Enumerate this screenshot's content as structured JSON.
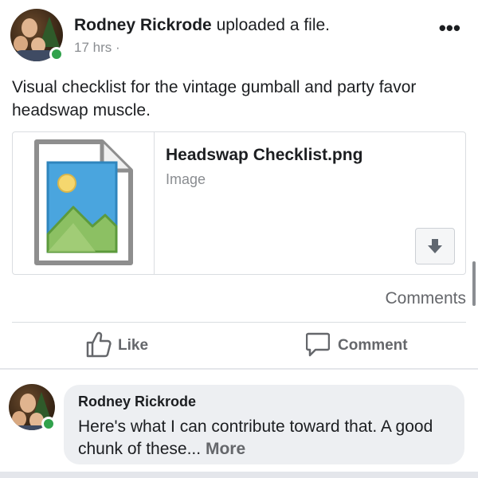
{
  "post": {
    "author": "Rodney Rickrode",
    "action": "uploaded a file.",
    "timestamp": "17 hrs ·",
    "more_menu": "•••",
    "text": "Visual checklist for the vintage gumball and party favor headswap muscle.",
    "avatar_icon": "profile-photo",
    "online_color": "#31a24c"
  },
  "attachment": {
    "file_name": "Headswap Checklist.png",
    "file_type": "Image",
    "thumbnail_icon": "image-file-icon",
    "download_icon": "download-arrow-icon"
  },
  "engagement": {
    "comments_label": "Comments"
  },
  "actions": {
    "like_label": "Like",
    "comment_label": "Comment"
  },
  "comment": {
    "author": "Rodney Rickrode",
    "text": "Here's what I can contribute toward that. A good chunk of these...",
    "more_label": "More"
  },
  "colors": {
    "text": "#1c1e21",
    "secondary_text": "#65676b",
    "muted_text": "#8a8d91",
    "bubble_bg": "#edeff2",
    "online": "#31a24c"
  }
}
